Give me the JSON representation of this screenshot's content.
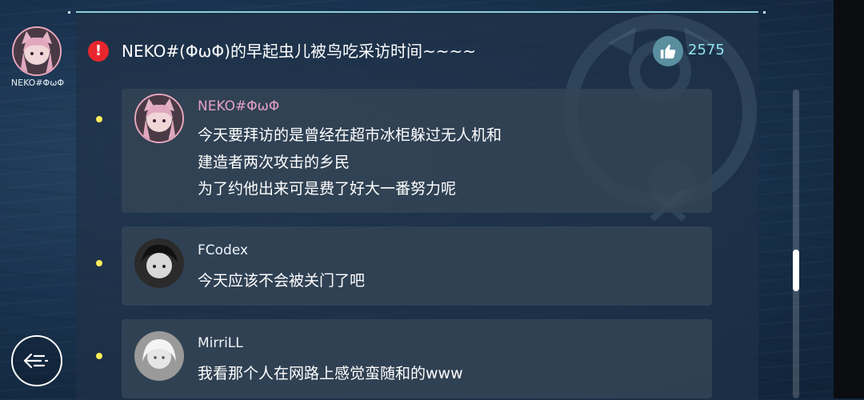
{
  "poster": {
    "name": "NEKO#ΦωΦ"
  },
  "post": {
    "title": "NEKO#(ΦωΦ)的早起虫儿被鸟吃采访时间~~~~",
    "likes": "2575"
  },
  "comments": [
    {
      "author": "NEKO#ΦωΦ",
      "lines": [
        "今天要拜访的是曾经在超市冰柜躲过无人机和",
        "建造者两次攻击的乡民",
        "为了约他出来可是费了好大一番努力呢"
      ]
    },
    {
      "author": "FCodex",
      "lines": [
        "今天应该不会被关门了吧"
      ]
    },
    {
      "author": "MirriLL",
      "lines": [
        "我看那个人在网路上感觉蛮随和的www"
      ]
    }
  ],
  "icons": {
    "alert": "alert-icon",
    "like": "thumbs-up-icon",
    "back": "back-menu-icon"
  },
  "colors": {
    "alert": "#e9262d",
    "accent": "#8fe4f0",
    "bullet": "#ffee58",
    "author_pink": "#e5a0c4"
  }
}
